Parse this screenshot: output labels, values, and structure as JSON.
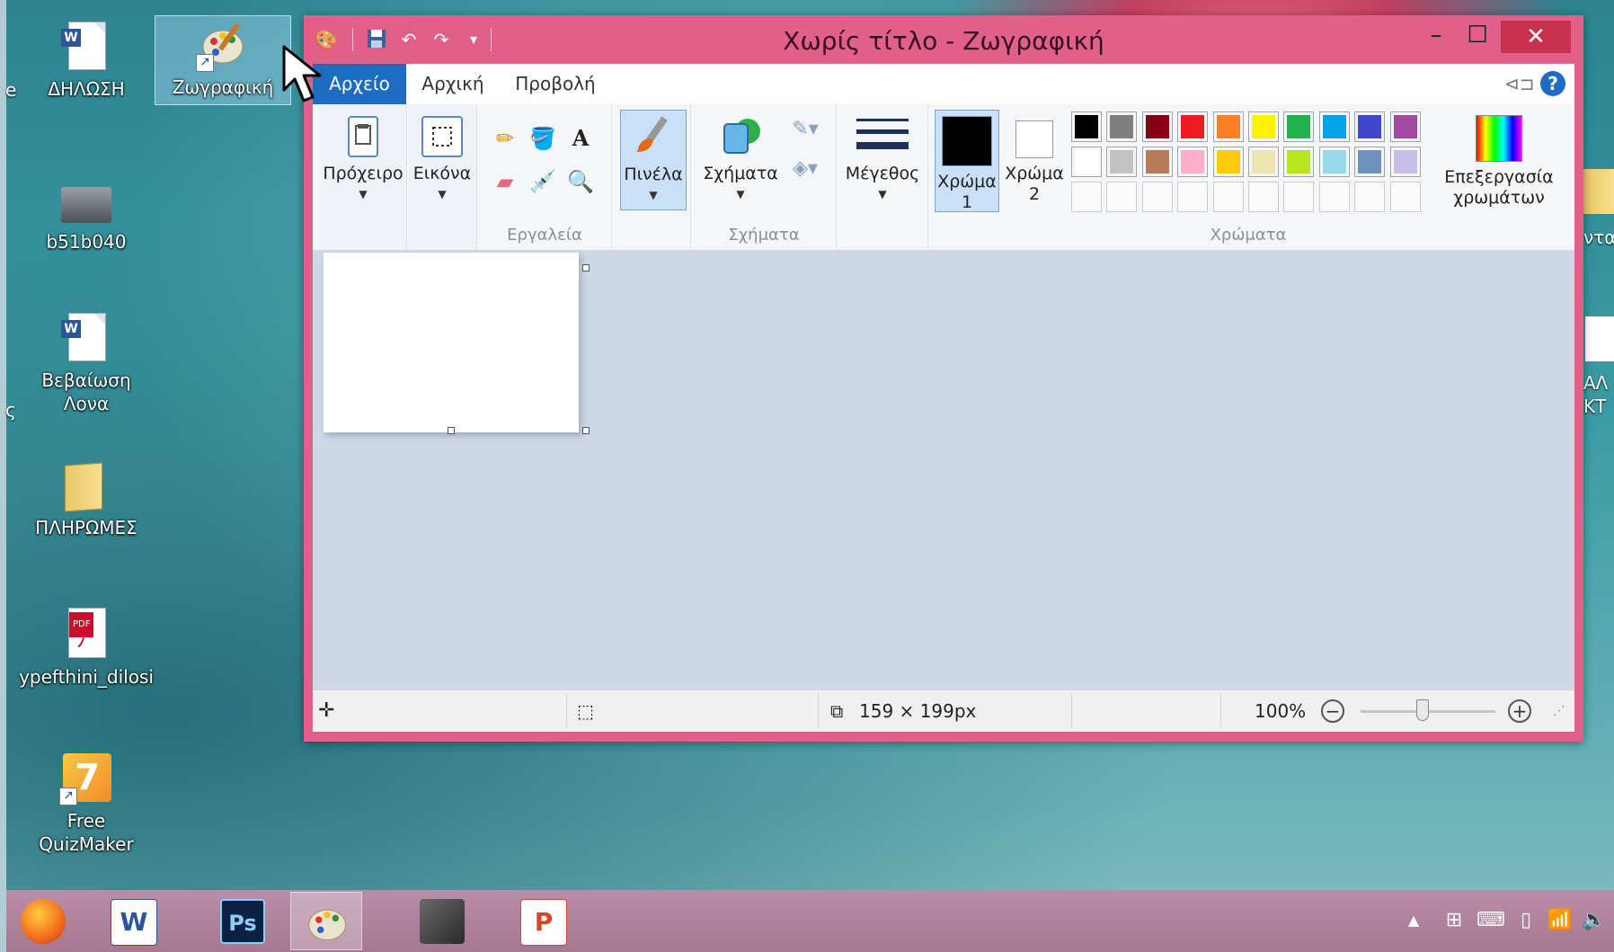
{
  "desktop": {
    "icons": [
      {
        "label": "ΔΗΛΩΣΗ"
      },
      {
        "label": "Ζωγραφική"
      },
      {
        "label": "b51b040"
      },
      {
        "label": "Βεβαίωση Λονα"
      },
      {
        "label": "ΠΛΗΡΩΜΕΣ"
      },
      {
        "label": "ypefthini_dilosi"
      },
      {
        "label": "Free QuizMaker"
      }
    ],
    "edge_left": [
      "e",
      "ς"
    ],
    "edge_right": [
      "ντα",
      "ΑΛ",
      "ΚΤ"
    ]
  },
  "window": {
    "title": "Χωρίς τίτλο - Ζωγραφική",
    "minimize": "–",
    "maximize": "☐",
    "close": "✕"
  },
  "tabs": {
    "file": "Αρχείο",
    "home": "Αρχική",
    "view": "Προβολή"
  },
  "ribbon": {
    "clipboard": "Πρόχειρο",
    "image": "Εικόνα",
    "tools_group": "Εργαλεία",
    "brushes": "Πινέλα",
    "shapes": "Σχήματα",
    "shapes_group": "Σχήματα",
    "size": "Μέγεθος",
    "color1": "Χρώμα",
    "color1_num": "1",
    "color2": "Χρώμα",
    "color2_num": "2",
    "edit_colors_1": "Επεξεργασία",
    "edit_colors_2": "χρωμάτων",
    "colors_group": "Χρώματα"
  },
  "palette": {
    "row1": [
      "#000000",
      "#7f7f7f",
      "#880015",
      "#ed1c24",
      "#ff7f27",
      "#fff200",
      "#22b14c",
      "#00a2e8",
      "#3f48cc",
      "#a349a4"
    ],
    "row2": [
      "#ffffff",
      "#c3c3c3",
      "#b97a57",
      "#ffaec9",
      "#ffc90e",
      "#efe4b0",
      "#b5e61d",
      "#99d9ea",
      "#7092be",
      "#c8bfe7"
    ]
  },
  "status": {
    "canvas_size": "159 × 199px",
    "zoom": "100%"
  }
}
